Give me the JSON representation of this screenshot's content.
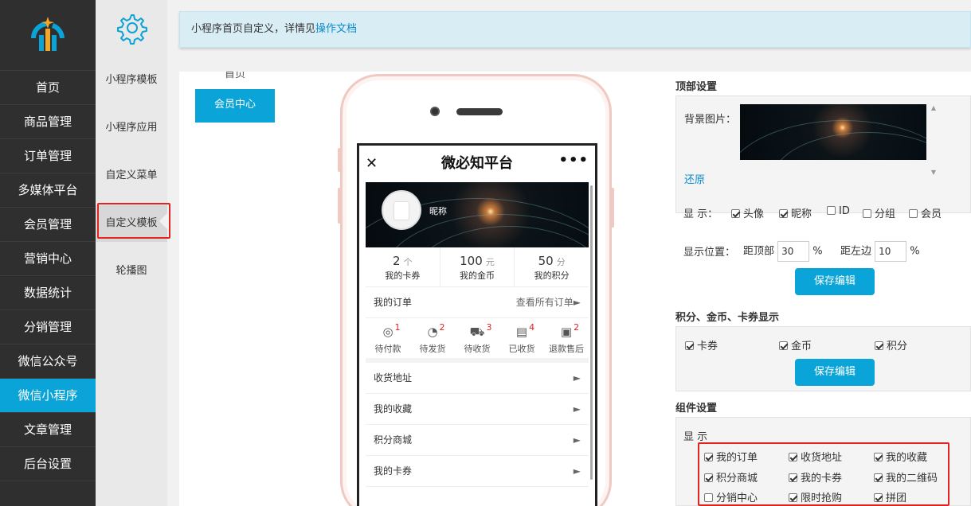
{
  "sidebar": {
    "items": [
      {
        "label": "首页"
      },
      {
        "label": "商品管理"
      },
      {
        "label": "订单管理"
      },
      {
        "label": "多媒体平台"
      },
      {
        "label": "会员管理"
      },
      {
        "label": "营销中心"
      },
      {
        "label": "数据统计"
      },
      {
        "label": "分销管理"
      },
      {
        "label": "微信公众号"
      },
      {
        "label": "微信小程序"
      },
      {
        "label": "文章管理"
      },
      {
        "label": "后台设置"
      }
    ]
  },
  "subnav": {
    "items": [
      {
        "label": "小程序模板"
      },
      {
        "label": "小程序应用"
      },
      {
        "label": "自定义菜单"
      },
      {
        "label": "自定义模板"
      },
      {
        "label": "轮播图"
      }
    ]
  },
  "notice": {
    "text": "小程序首页自定义，详情见",
    "link": "操作文档"
  },
  "page_tabs": [
    {
      "label": "首页"
    },
    {
      "label": "会员中心"
    }
  ],
  "preview": {
    "title": "微必知平台",
    "close_glyph": "✕",
    "more_glyph": "•••",
    "nickname": "昵称",
    "stats": [
      {
        "num": "2",
        "unit": "个",
        "label": "我的卡券"
      },
      {
        "num": "100",
        "unit": "元",
        "label": "我的金币"
      },
      {
        "num": "50",
        "unit": "分",
        "label": "我的积分"
      }
    ],
    "orders_title": "我的订单",
    "orders_all": "查看所有订单►",
    "order_icons": [
      {
        "label": "待付款",
        "badge": "1"
      },
      {
        "label": "待发货",
        "badge": "2"
      },
      {
        "label": "待收货",
        "badge": "3"
      },
      {
        "label": "已收货",
        "badge": "4"
      },
      {
        "label": "退款售后",
        "badge": "2"
      }
    ],
    "rows": [
      {
        "label": "收货地址",
        "arrow": "►"
      },
      {
        "label": "我的收藏",
        "arrow": "►"
      },
      {
        "label": "积分商城",
        "arrow": "►"
      },
      {
        "label": "我的卡券",
        "arrow": "►"
      }
    ]
  },
  "settings": {
    "top": {
      "title": "顶部设置",
      "bg_label": "背景图片：",
      "restore": "还原",
      "display_label": "显 示：",
      "display_options": [
        {
          "label": "头像",
          "checked": true
        },
        {
          "label": "昵称",
          "checked": true
        },
        {
          "label": "ID",
          "checked": false
        },
        {
          "label": "分组",
          "checked": false
        },
        {
          "label": "会员",
          "checked": false
        }
      ],
      "position_label": "显示位置：",
      "top_label": "距顶部",
      "top_value": "30",
      "left_label": "距左边",
      "left_value": "10",
      "percent": "%",
      "save": "保存编辑"
    },
    "points": {
      "title": "积分、金币、卡券显示",
      "options": [
        {
          "label": "卡券",
          "checked": true
        },
        {
          "label": "金币",
          "checked": true
        },
        {
          "label": "积分",
          "checked": true
        }
      ],
      "save": "保存编辑"
    },
    "components": {
      "title": "组件设置",
      "display_label": "显 示",
      "options": [
        {
          "label": "我的订单",
          "checked": true
        },
        {
          "label": "收货地址",
          "checked": true
        },
        {
          "label": "我的收藏",
          "checked": true
        },
        {
          "label": "积分商城",
          "checked": true
        },
        {
          "label": "我的卡券",
          "checked": true
        },
        {
          "label": "我的二维码",
          "checked": true
        },
        {
          "label": "分销中心",
          "checked": false
        },
        {
          "label": "限时抢购",
          "checked": true
        },
        {
          "label": "拼团",
          "checked": true
        }
      ]
    }
  },
  "colors": {
    "accent": "#0aa4d8",
    "sidebar": "#2f2f2f",
    "highlight": "#e3231f"
  }
}
